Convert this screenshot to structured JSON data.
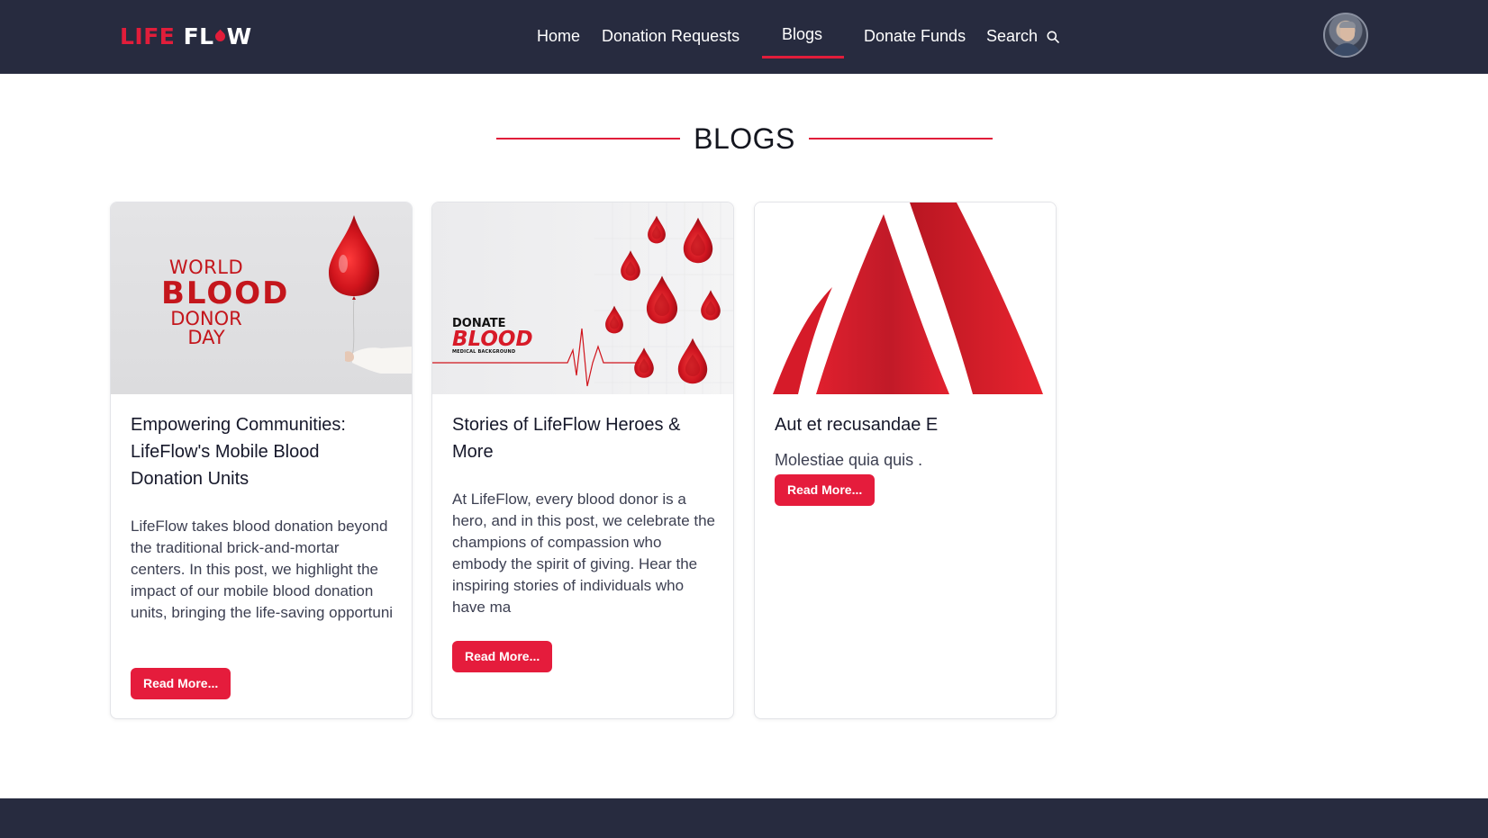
{
  "brand": {
    "logo_part1": "LIFE",
    "logo_part2a": "FL",
    "logo_part2b": "W"
  },
  "nav": {
    "home": "Home",
    "donation_requests": "Donation Requests",
    "blogs": "Blogs",
    "donate_funds": "Donate Funds",
    "search": "Search",
    "active": "Blogs"
  },
  "section": {
    "title": "BLOGS"
  },
  "cards": [
    {
      "title": "Empowering Communities: LifeFlow's Mobile Blood Donation Units",
      "description": "LifeFlow takes blood donation beyond the traditional brick-and-mortar centers. In this post, we highlight the impact of our mobile blood donation units, bringing the life-saving opportuni",
      "button": "Read More...",
      "image_text": {
        "line1": "WORLD",
        "line2": "BLOOD",
        "line3": "DONOR DAY"
      }
    },
    {
      "title": "Stories of LifeFlow Heroes & More",
      "description": "At LifeFlow, every blood donor is a hero, and in this post, we celebrate the champions of compassion who embody the spirit of giving. Hear the inspiring stories of individuals who have ma",
      "button": "Read More...",
      "image_text": {
        "line1": "DONATE",
        "line2": "BLOOD",
        "line3": "MEDICAL BACKGROUND"
      }
    },
    {
      "title": "Aut et recusandae E",
      "description": "Molestiae quia quis .",
      "button": "Read More..."
    }
  ],
  "colors": {
    "brand_red": "#e11d3a",
    "nav_bg": "#272b3f",
    "button_red": "#e51c3c"
  }
}
